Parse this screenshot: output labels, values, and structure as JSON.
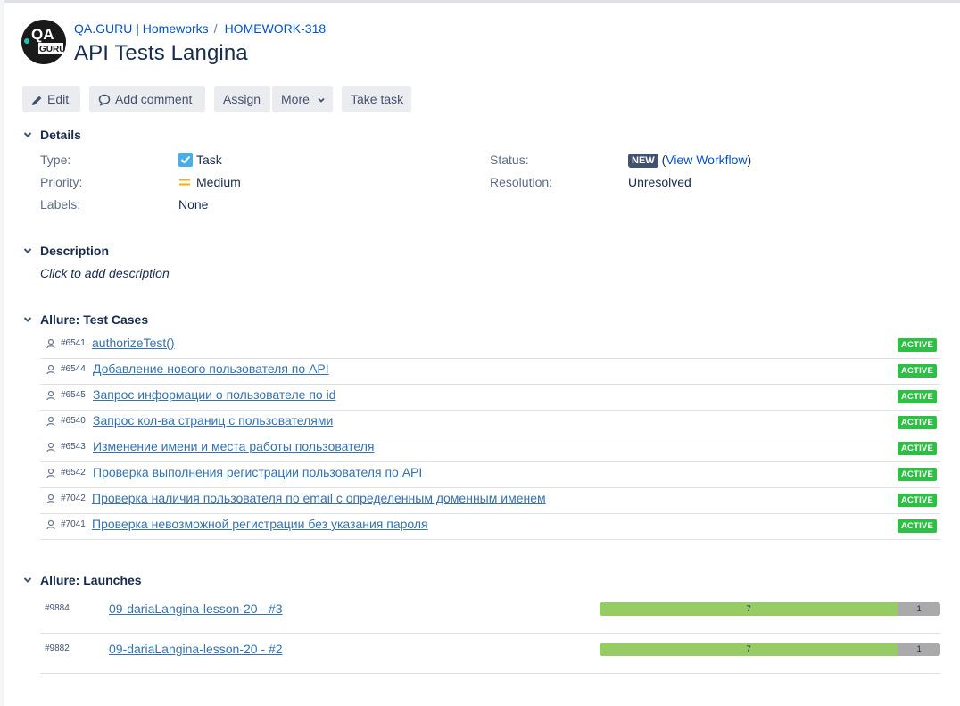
{
  "breadcrumb": {
    "project": "QA.GURU | Homeworks",
    "separator": "/",
    "issue_key": "HOMEWORK-318"
  },
  "logo": {
    "text_top": "QA",
    "text_bottom": "GURU"
  },
  "issue_title": "API Tests Langina",
  "toolbar": {
    "edit": "Edit",
    "add_comment": "Add comment",
    "assign": "Assign",
    "more": "More",
    "take_task": "Take task"
  },
  "details": {
    "heading": "Details",
    "type_label": "Type:",
    "type_value": "Task",
    "priority_label": "Priority:",
    "priority_value": "Medium",
    "labels_label": "Labels:",
    "labels_value": "None",
    "status_label": "Status:",
    "status_value": "NEW",
    "workflow_link": "View Workflow",
    "resolution_label": "Resolution:",
    "resolution_value": "Unresolved"
  },
  "description": {
    "heading": "Description",
    "hint": "Click to add description"
  },
  "test_cases": {
    "heading": "Allure: Test Cases",
    "items": [
      {
        "id": "#6541",
        "name": "authorizeTest()",
        "status": "ACTIVE"
      },
      {
        "id": "#6544",
        "name": "Добавление нового пользователя по API",
        "status": "ACTIVE"
      },
      {
        "id": "#6545",
        "name": "Запрос информации о пользователе по id",
        "status": "ACTIVE"
      },
      {
        "id": "#6540",
        "name": "Запрос кол-ва страниц с пользователями",
        "status": "ACTIVE"
      },
      {
        "id": "#6543",
        "name": "Изменение имени и места работы пользователя",
        "status": "ACTIVE"
      },
      {
        "id": "#6542",
        "name": "Проверка выполнения регистрации пользователя по API",
        "status": "ACTIVE"
      },
      {
        "id": "#7042",
        "name": "Проверка наличия пользователя по email с определенным доменным именем",
        "status": "ACTIVE"
      },
      {
        "id": "#7041",
        "name": "Проверка невозможной регистрации без указания пароля",
        "status": "ACTIVE"
      }
    ]
  },
  "launches": {
    "heading": "Allure: Launches",
    "items": [
      {
        "id": "#9884",
        "name": "09-dariaLangina-lesson-20 - #3",
        "passed": "7",
        "skipped": "1"
      },
      {
        "id": "#9882",
        "name": "09-dariaLangina-lesson-20 - #2",
        "passed": "7",
        "skipped": "1"
      }
    ]
  },
  "colors": {
    "link": "#0052cc",
    "active_badge": "#2fbf46",
    "passed": "#97cc64",
    "skipped": "#aaaaaa",
    "status_new": "#42526e"
  }
}
